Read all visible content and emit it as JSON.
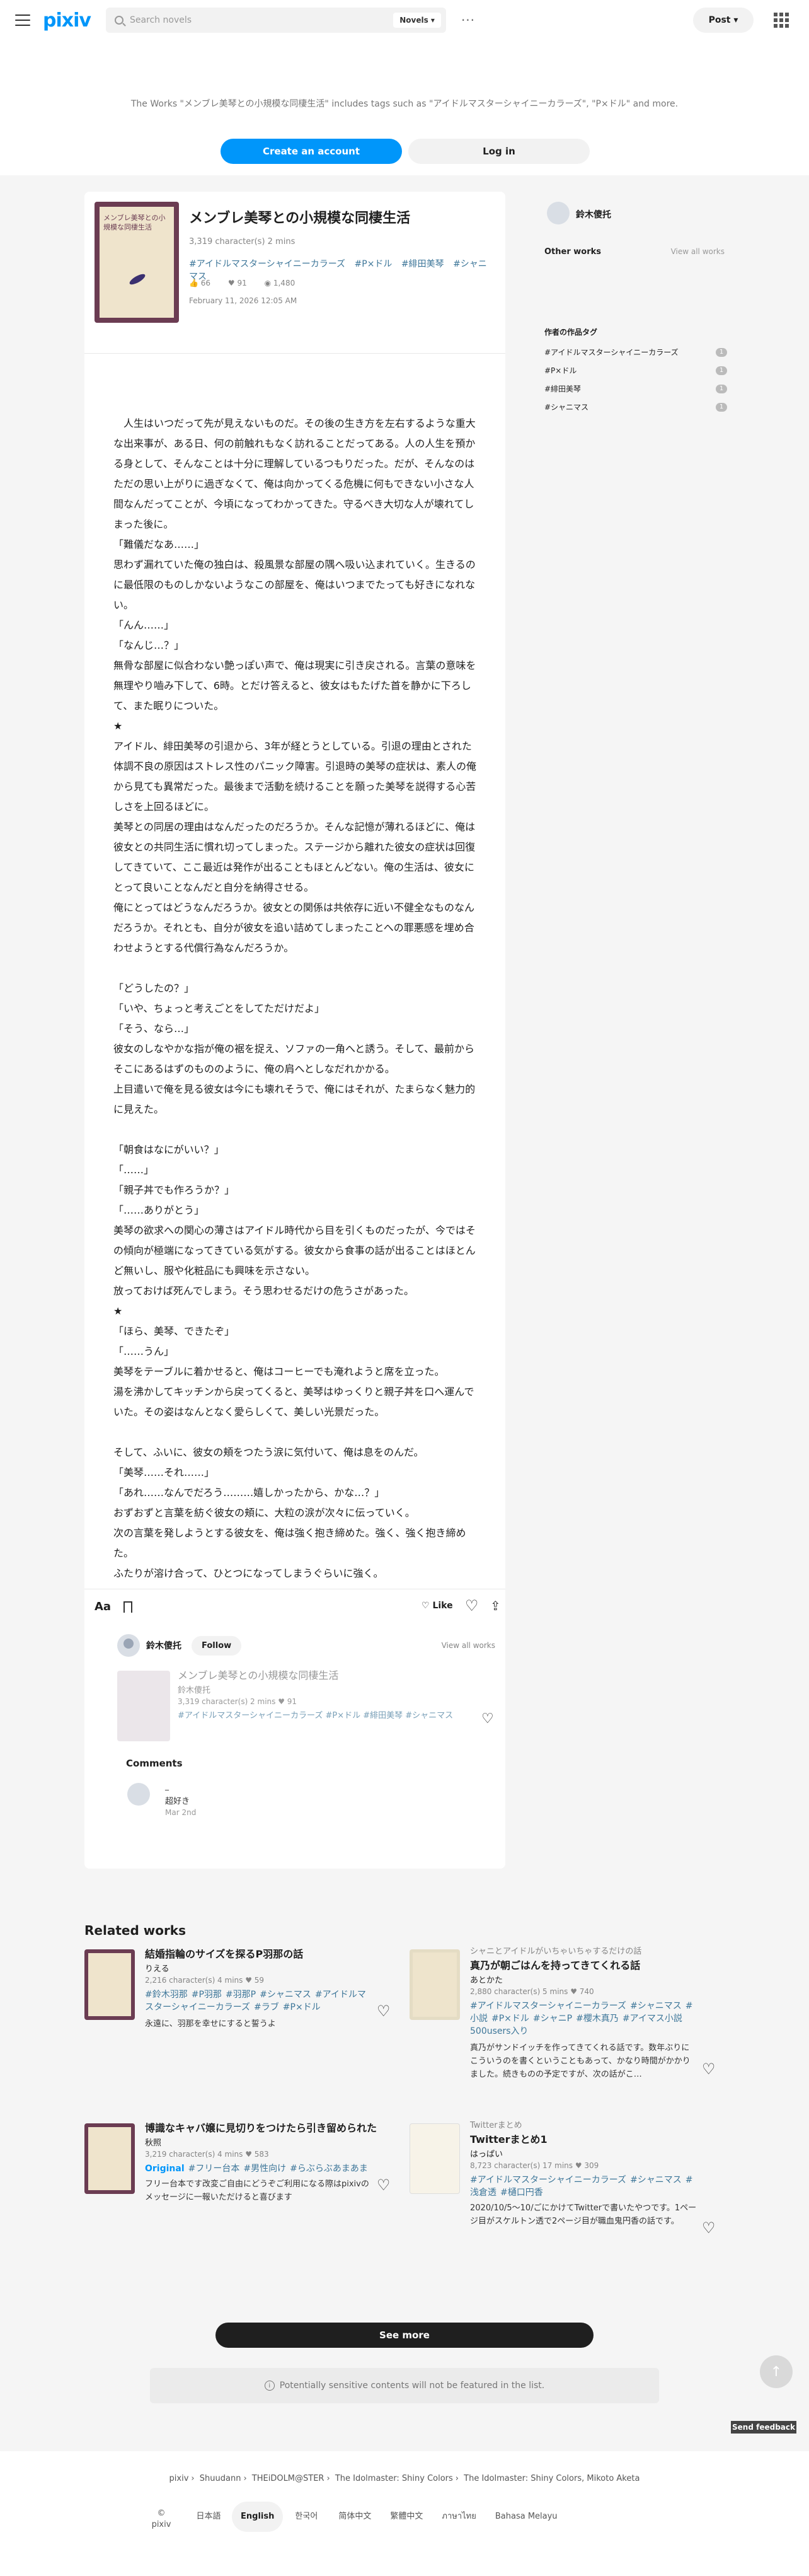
{
  "header": {
    "logo": "pixiv",
    "search_placeholder": "Search novels",
    "search_type": "Novels",
    "more": "···",
    "post": "Post"
  },
  "banner": {
    "text": "The Works \"メンブレ美琴との小規模な同棲生活\" includes tags such as \"アイドルマスターシャイニーカラーズ\", \"P×ドル\" and more.",
    "create": "Create an account",
    "login": "Log in"
  },
  "work": {
    "title": "メンブレ美琴との小規模な同棲生活",
    "meta": "3,319 character(s)  2 mins",
    "tags": [
      "#アイドルマスターシャイニーカラーズ",
      "#P×ドル",
      "#緋田美琴",
      "#シャニマス"
    ],
    "likes": "66",
    "bookmarks": "91",
    "views": "1,480",
    "date": "February 11, 2026 12:05 AM",
    "cover_text": "メンブレ美琴との小規模な同棲生活"
  },
  "body": [
    "　人生はいつだって先が見えないものだ。その後の生き方を左右するような重大な出来事が、ある日、何の前触れもなく訪れることだってある。人の人生を預かる身として、そんなことは十分に理解しているつもりだった。だが、そんなのはただの思い上がりに過ぎなくて、俺は向かってくる危機に何もできない小さな人間なんだってことが、今頃になってわかってきた。守るべき大切な人が壊れてしまった後に。",
    "「難儀だなあ……」",
    "思わず漏れていた俺の独白は、殺風景な部屋の隅へ吸い込まれていく。生きるのに最低限のものしかないようなこの部屋を、俺はいつまでたっても好きになれない。",
    "「んん……」",
    "「なんじ…？」",
    "無骨な部屋に似合わない艶っぽい声で、俺は現実に引き戻される。言葉の意味を無理やり嚙み下して、6時。とだけ答えると、彼女はもたげた首を静かに下ろして、また眠りについた。",
    "★",
    "アイドル、緋田美琴の引退から、3年が経とうとしている。引退の理由とされた体調不良の原因はストレス性のパニック障害。引退時の美琴の症状は、素人の俺から見ても異常だった。最後まで活動を続けることを願った美琴を説得する心苦しさを上回るほどに。",
    "美琴との同居の理由はなんだったのだろうか。そんな記憶が薄れるほどに、俺は彼女との共同生活に慣れ切ってしまった。ステージから離れた彼女の症状は回復してきていて、ここ最近は発作が出ることもほとんどない。俺の生活は、彼女にとって良いことなんだと自分を納得させる。",
    "俺にとってはどうなんだろうか。彼女との関係は共依存に近い不健全なものなんだろうか。それとも、自分が彼女を追い詰めてしまったことへの罪悪感を埋め合わせようとする代償行為なんだろうか。",
    "",
    "「どうしたの？」",
    "「いや、ちょっと考えごとをしてただけだよ」",
    "「そう、なら…」",
    "彼女のしなやかな指が俺の裾を捉え、ソファの一角へと誘う。そして、最前からそこにあるはずのもののように、俺の肩へとしなだれかかる。",
    "上目遣いで俺を見る彼女は今にも壊れそうで、俺にはそれが、たまらなく魅力的に見えた。",
    "",
    "「朝食はなにがいい？」",
    "「……」",
    "「親子丼でも作ろうか？」",
    "「……ありがとう」",
    "美琴の欲求への関心の薄さはアイドル時代から目を引くものだったが、今ではその傾向が極端になってきている気がする。彼女から食事の話が出ることはほとんど無いし、服や化粧品にも興味を示さない。",
    "放っておけば死んでしまう。そう思わせるだけの危うさがあった。",
    "★",
    "「ほら、美琴、できたぞ」",
    "「……うん」",
    "美琴をテーブルに着かせると、俺はコーヒーでも淹れようと席を立った。",
    "湯を沸かしてキッチンから戻ってくると、美琴はゆっくりと親子丼を口へ運んでいた。その姿はなんとなく愛らしくて、美しい光景だった。",
    "",
    "そして、ふいに、彼女の頬をつたう涙に気付いて、俺は息をのんだ。",
    "「美琴……それ……」",
    "「あれ……なんでだろう………嬉しかったから、かな…？」",
    "おずおずと言葉を紡ぐ彼女の頬に、大粒の涙が次々に伝っていく。",
    "次の言葉を発しようとする彼女を、俺は強く抱き締めた。強く、強く抱き締めた。",
    "ふたりが溶け合って、ひとつになってしまうぐらいに強く。"
  ],
  "toolbar": {
    "aa": "Aa",
    "like": "Like"
  },
  "author": {
    "name": "鈴木傻托",
    "follow": "Follow",
    "view_all": "View all works"
  },
  "mini_card": {
    "title": "メンブレ美琴との小規模な同棲生活",
    "author": "鈴木傻托",
    "meta": "3,319 character(s)  2 mins  ♥ 91",
    "tags": "#アイドルマスターシャイニーカラーズ #P×ドル #緋田美琴 #シャニマス"
  },
  "comments": {
    "heading": "Comments",
    "items": [
      {
        "name": "_",
        "text": "超好き",
        "date": "Mar 2nd"
      }
    ]
  },
  "side": {
    "name": "鈴木傻托",
    "other_works": "Other works",
    "view_all": "View all works",
    "tags_title": "作者の作品タグ",
    "tags": [
      {
        "label": "#アイドルマスターシャイニーカラーズ",
        "count": "1"
      },
      {
        "label": "#P×ドル",
        "count": "1"
      },
      {
        "label": "#緋田美琴",
        "count": "1"
      },
      {
        "label": "#シャニマス",
        "count": "1"
      }
    ]
  },
  "related": {
    "heading": "Related works",
    "cards": [
      {
        "series": "",
        "title": "結婚指輪のサイズを探るP羽那の話",
        "author": "りえる",
        "meta": "2,216 character(s)  4 mins  ♥ 59",
        "tags": [
          "#鈴木羽那",
          "#P羽那",
          "#羽那P",
          "#シャニマス",
          "#アイドルマスターシャイニーカラーズ",
          "#ラブ",
          "#P×ドル"
        ],
        "summary": "永遠に、羽那を幸せにすると誓うよ"
      },
      {
        "series": "シャニとアイドルがいちゃいちゃするだけの話",
        "title": "真乃が朝ごはんを持ってきてくれる話",
        "author": "あとかた",
        "meta": "2,880 character(s)  5 mins  ♥ 740",
        "tags": [
          "#アイドルマスターシャイニーカラーズ",
          "#シャニマス",
          "#小説",
          "#P×ドル",
          "#シャニP",
          "#櫻木真乃",
          "#アイマス小説500users入り"
        ],
        "summary": "真乃がサンドイッチを作ってきてくれる話です。数年ぶりにこういうのを書くということもあって、かなり時間がかかりました。続きものの予定ですが、次の話がこ…"
      },
      {
        "series": "",
        "title": "博識なキャバ嬢に見切りをつけたら引き留められた",
        "author": "秋照",
        "meta": "3,219 character(s)  4 mins  ♥ 583",
        "tags": [
          "Original",
          "#フリー台本",
          "#男性向け",
          "#らぶらぶあまあま"
        ],
        "summary": "フリー台本です改変ご自由にどうぞご利用になる際はpixivのメッセージに一報いただけると喜びます"
      },
      {
        "series": "Twitterまとめ",
        "title": "Twitterまとめ1",
        "author": "はっぱい",
        "meta": "8,723 character(s)  17 mins  ♥ 309",
        "tags": [
          "#アイドルマスターシャイニーカラーズ",
          "#シャニマス",
          "#浅倉透",
          "#樋口円香"
        ],
        "summary": "2020/10/5〜10/ごにかけてTwitterで書いたやつです。1ページ目がスケルトン透で2ページ目が職血鬼円香の話です。"
      }
    ]
  },
  "see_more": "See more",
  "notice": "Potentially sensitive contents will not be featured in the list.",
  "feedback": "Send feedback",
  "footer": {
    "crumbs": [
      "pixiv",
      "Shuudann",
      "THEiDOLM@STER",
      "The Idolmaster: Shiny Colors",
      "The Idolmaster: Shiny Colors, Mikoto Aketa"
    ],
    "copyright": "© pixiv",
    "languages": [
      "日本語",
      "English",
      "한국어",
      "简体中文",
      "繁體中文",
      "ภาษาไทย",
      "Bahasa Melayu"
    ],
    "current_language": "English"
  }
}
